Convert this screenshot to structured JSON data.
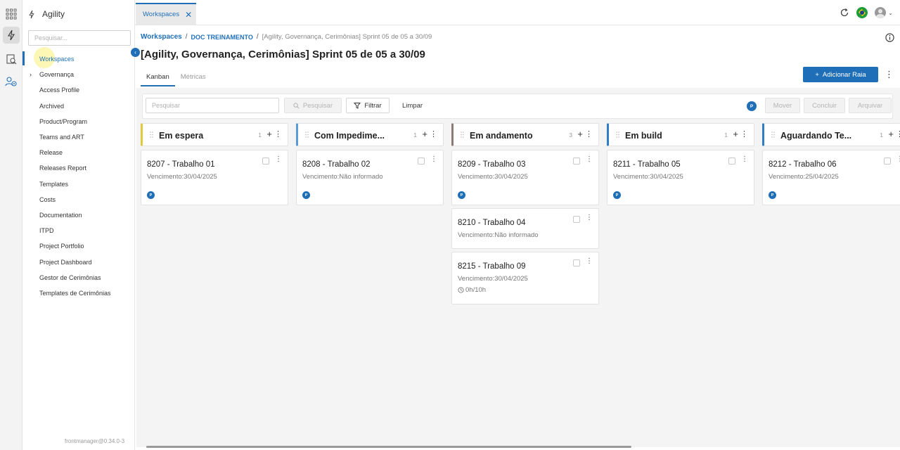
{
  "app": {
    "name": "Agility"
  },
  "sidebar": {
    "search_placeholder": "Pesquisar...",
    "items": [
      {
        "label": "Workspaces",
        "active": true
      },
      {
        "label": "Governança",
        "expandable": true
      },
      {
        "label": "Access Profile"
      },
      {
        "label": "Archived"
      },
      {
        "label": "Product/Program"
      },
      {
        "label": "Teams and ART"
      },
      {
        "label": "Release"
      },
      {
        "label": "Releases Report"
      },
      {
        "label": "Templates"
      },
      {
        "label": "Costs"
      },
      {
        "label": "Documentation"
      },
      {
        "label": "ITPD"
      },
      {
        "label": "Project Portfolio"
      },
      {
        "label": "Project Dashboard"
      },
      {
        "label": "Gestor de Cerimônias"
      },
      {
        "label": "Templates de Cerimônias"
      }
    ],
    "version": "frontmanager@0.34.0-3"
  },
  "tabs": [
    {
      "label": "Workspaces"
    }
  ],
  "breadcrumb": {
    "items": [
      "Workspaces",
      "DOC TREINAMENTO"
    ],
    "separator": "/",
    "current": "[Agility, Governança, Cerimônias] Sprint 05 de 05 a 30/09"
  },
  "page": {
    "title": "[Agility, Governança, Cerimônias] Sprint 05 de 05 a 30/09",
    "view_tabs": [
      {
        "label": "Kanban",
        "active": true
      },
      {
        "label": "Métricas",
        "active": false
      }
    ],
    "add_lane_label": "Adicionar Raia"
  },
  "toolbar": {
    "search_placeholder": "Pesquisar",
    "search_button": "Pesquisar",
    "filter_button": "Filtrar",
    "clear_button": "Limpar",
    "user_badge": "P",
    "move_button": "Mover",
    "complete_button": "Concluir",
    "archive_button": "Arquivar"
  },
  "lanes": [
    {
      "title": "Em espera",
      "count": "1",
      "color": "#e0c93a",
      "cards": [
        {
          "title": "8207 - Trabalho 01",
          "due": "Vencimento:30/04/2025",
          "badge": "P"
        }
      ]
    },
    {
      "title": "Com Impedime...",
      "count": "1",
      "color": "#5b9bd5",
      "cards": [
        {
          "title": "8208 - Trabalho 02",
          "due": "Vencimento:Não informado",
          "badge": "P"
        }
      ]
    },
    {
      "title": "Em andamento",
      "count": "3",
      "color": "#8c7b70",
      "cards": [
        {
          "title": "8209 - Trabalho 03",
          "due": "Vencimento:30/04/2025",
          "badge": "P"
        },
        {
          "title": "8210 - Trabalho 04",
          "due": "Vencimento:Não informado"
        },
        {
          "title": "8215 - Trabalho 09",
          "due": "Vencimento:30/04/2025",
          "time": "0h/10h"
        }
      ]
    },
    {
      "title": "Em build",
      "count": "1",
      "color": "#2f7dc4",
      "cards": [
        {
          "title": "8211 - Trabalho 05",
          "due": "Vencimento:30/04/2025",
          "badge": "P"
        }
      ]
    },
    {
      "title": "Aguardando Te...",
      "count": "1",
      "color": "#2f7dc4",
      "cards": [
        {
          "title": "8212 - Trabalho 06",
          "due": "Vencimento:25/04/2025",
          "badge": "P"
        }
      ]
    }
  ]
}
